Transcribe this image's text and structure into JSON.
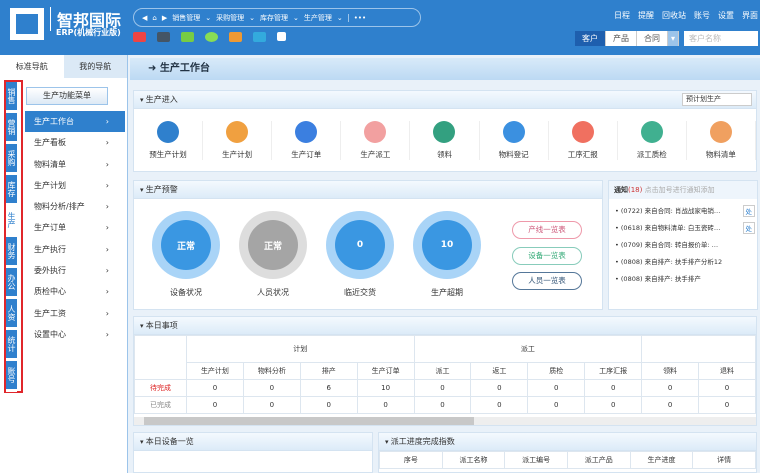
{
  "header": {
    "logo_name": "智邦国际",
    "logo_sub": "ERP(机械行业版)",
    "nav": [
      "销售管理",
      "采购管理",
      "库存管理",
      "生产管理"
    ],
    "links": [
      "日程",
      "提醒",
      "回收站",
      "账号",
      "设置",
      "界面"
    ],
    "search_tabs": [
      "客户",
      "产品",
      "合同"
    ],
    "search_placeholder": "客户名称"
  },
  "left": {
    "tabs": [
      "标准导航",
      "我的导航"
    ],
    "rail": [
      "销售",
      "营销",
      "采购",
      "库存",
      "生产",
      "财务",
      "办公",
      "人资",
      "统计",
      "账号"
    ],
    "menu_button": "生产功能菜单",
    "menu": [
      "生产工作台",
      "生产看板",
      "物料清单",
      "生产计划",
      "物料分析/排产",
      "生产订单",
      "生产执行",
      "委外执行",
      "质检中心",
      "生产工资",
      "设置中心"
    ]
  },
  "crumb": "生产工作台",
  "entry": {
    "title": "生产进入",
    "select": "预计划生产",
    "items": [
      {
        "label": "预生产计划",
        "color": "#2f80cd"
      },
      {
        "label": "生产计划",
        "color": "#f0a040"
      },
      {
        "label": "生产订单",
        "color": "#3b7fe0"
      },
      {
        "label": "生产派工",
        "color": "#f2a0a0"
      },
      {
        "label": "领料",
        "color": "#33a080"
      },
      {
        "label": "物料登记",
        "color": "#3b90e0"
      },
      {
        "label": "工序汇报",
        "color": "#f07060"
      },
      {
        "label": "派工质检",
        "color": "#40b090"
      },
      {
        "label": "物料清单",
        "color": "#f0a060"
      }
    ]
  },
  "warning": {
    "title": "生产预警",
    "items": [
      {
        "value": "正常",
        "label": "设备状况"
      },
      {
        "value": "正常",
        "label": "人员状况"
      },
      {
        "value": "0",
        "label": "临近交货"
      },
      {
        "value": "10",
        "label": "生产超期"
      }
    ],
    "buttons": [
      "产线一览表",
      "设备一览表",
      "人员一览表"
    ]
  },
  "notice": {
    "title": "通知",
    "count": "(18)",
    "hint": "点击加号进行通知添加",
    "action": "处",
    "items": [
      "(0722) 来自合同: 肖战战家电销…",
      "(0618) 来自物料清单: 白玉瓷砖…",
      "(0709) 来自合同: 转自报价单: …",
      "(0808) 来自排产: 扶手排产分析12",
      "(0808) 来自排产: 扶手排产"
    ]
  },
  "today": {
    "title": "本日事项",
    "groups": [
      "计划",
      "派工"
    ],
    "cols": [
      "生产计划",
      "物料分析",
      "排产",
      "生产订单",
      "派工",
      "返工",
      "质检",
      "工序汇报",
      "领料",
      "退料"
    ],
    "rows": [
      {
        "label": "待完成",
        "values": [
          "0",
          "0",
          "6",
          "10",
          "0",
          "0",
          "0",
          "0",
          "0",
          "0"
        ]
      },
      {
        "label": "已完成",
        "values": [
          "0",
          "0",
          "0",
          "0",
          "0",
          "0",
          "0",
          "0",
          "0",
          "0"
        ]
      }
    ]
  },
  "devices": {
    "title": "本日设备一览"
  },
  "progress": {
    "title": "派工进度完成指数",
    "cols": [
      "序号",
      "派工名称",
      "派工编号",
      "派工产品",
      "生产进度",
      "详情"
    ]
  }
}
